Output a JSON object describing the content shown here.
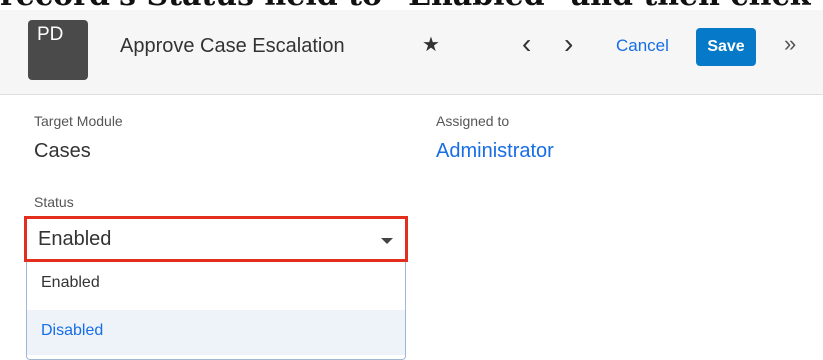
{
  "instruction_caption": "record's Status field to \"Enabled\" and then click th",
  "header": {
    "avatar_initials": "PD",
    "record_name": "Approve Case Escalation",
    "favorite_icon": "star-icon",
    "prev_icon": "chevron-left-icon",
    "next_icon": "chevron-right-icon",
    "cancel_label": "Cancel",
    "save_label": "Save",
    "more_icon": "double-chevron-right-icon"
  },
  "fields": {
    "target_module": {
      "label": "Target Module",
      "value": "Cases"
    },
    "assigned_to": {
      "label": "Assigned to",
      "value": "Administrator"
    },
    "status": {
      "label": "Status",
      "selected": "Enabled",
      "options": [
        "Enabled",
        "Disabled"
      ],
      "highlighted_option": "Disabled"
    }
  },
  "colors": {
    "link_blue": "#176de5",
    "save_button": "#0679c8",
    "highlight_red": "#e32d1d",
    "avatar_bg": "#4a4a4a"
  }
}
